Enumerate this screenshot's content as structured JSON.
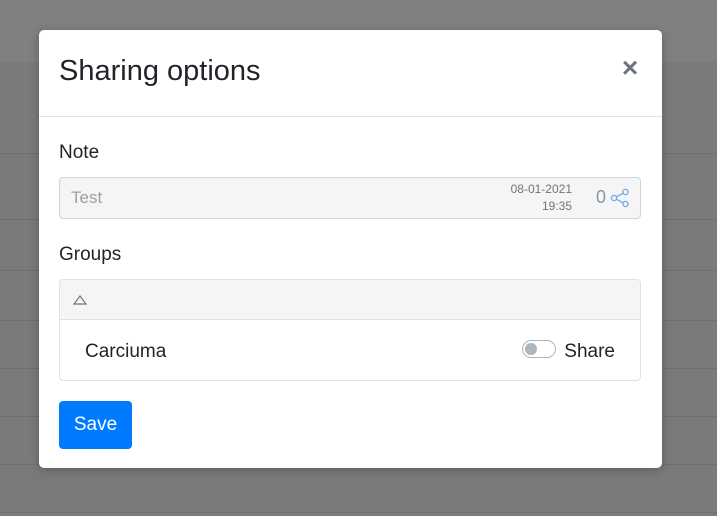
{
  "modal": {
    "title": "Sharing options",
    "close_label": "×"
  },
  "note": {
    "label": "Note",
    "value": "Test",
    "date": "08-01-2021",
    "time": "19:35",
    "share_count": "0",
    "share_icon": "share-icon"
  },
  "groups": {
    "label": "Groups",
    "collapse_icon": "triangle-up-icon",
    "items": [
      {
        "name": "Carciuma",
        "toggle_label": "Share",
        "shared": false
      }
    ]
  },
  "actions": {
    "save_label": "Save"
  },
  "colors": {
    "primary": "#007bff",
    "overlay": "#7a7a7a"
  }
}
